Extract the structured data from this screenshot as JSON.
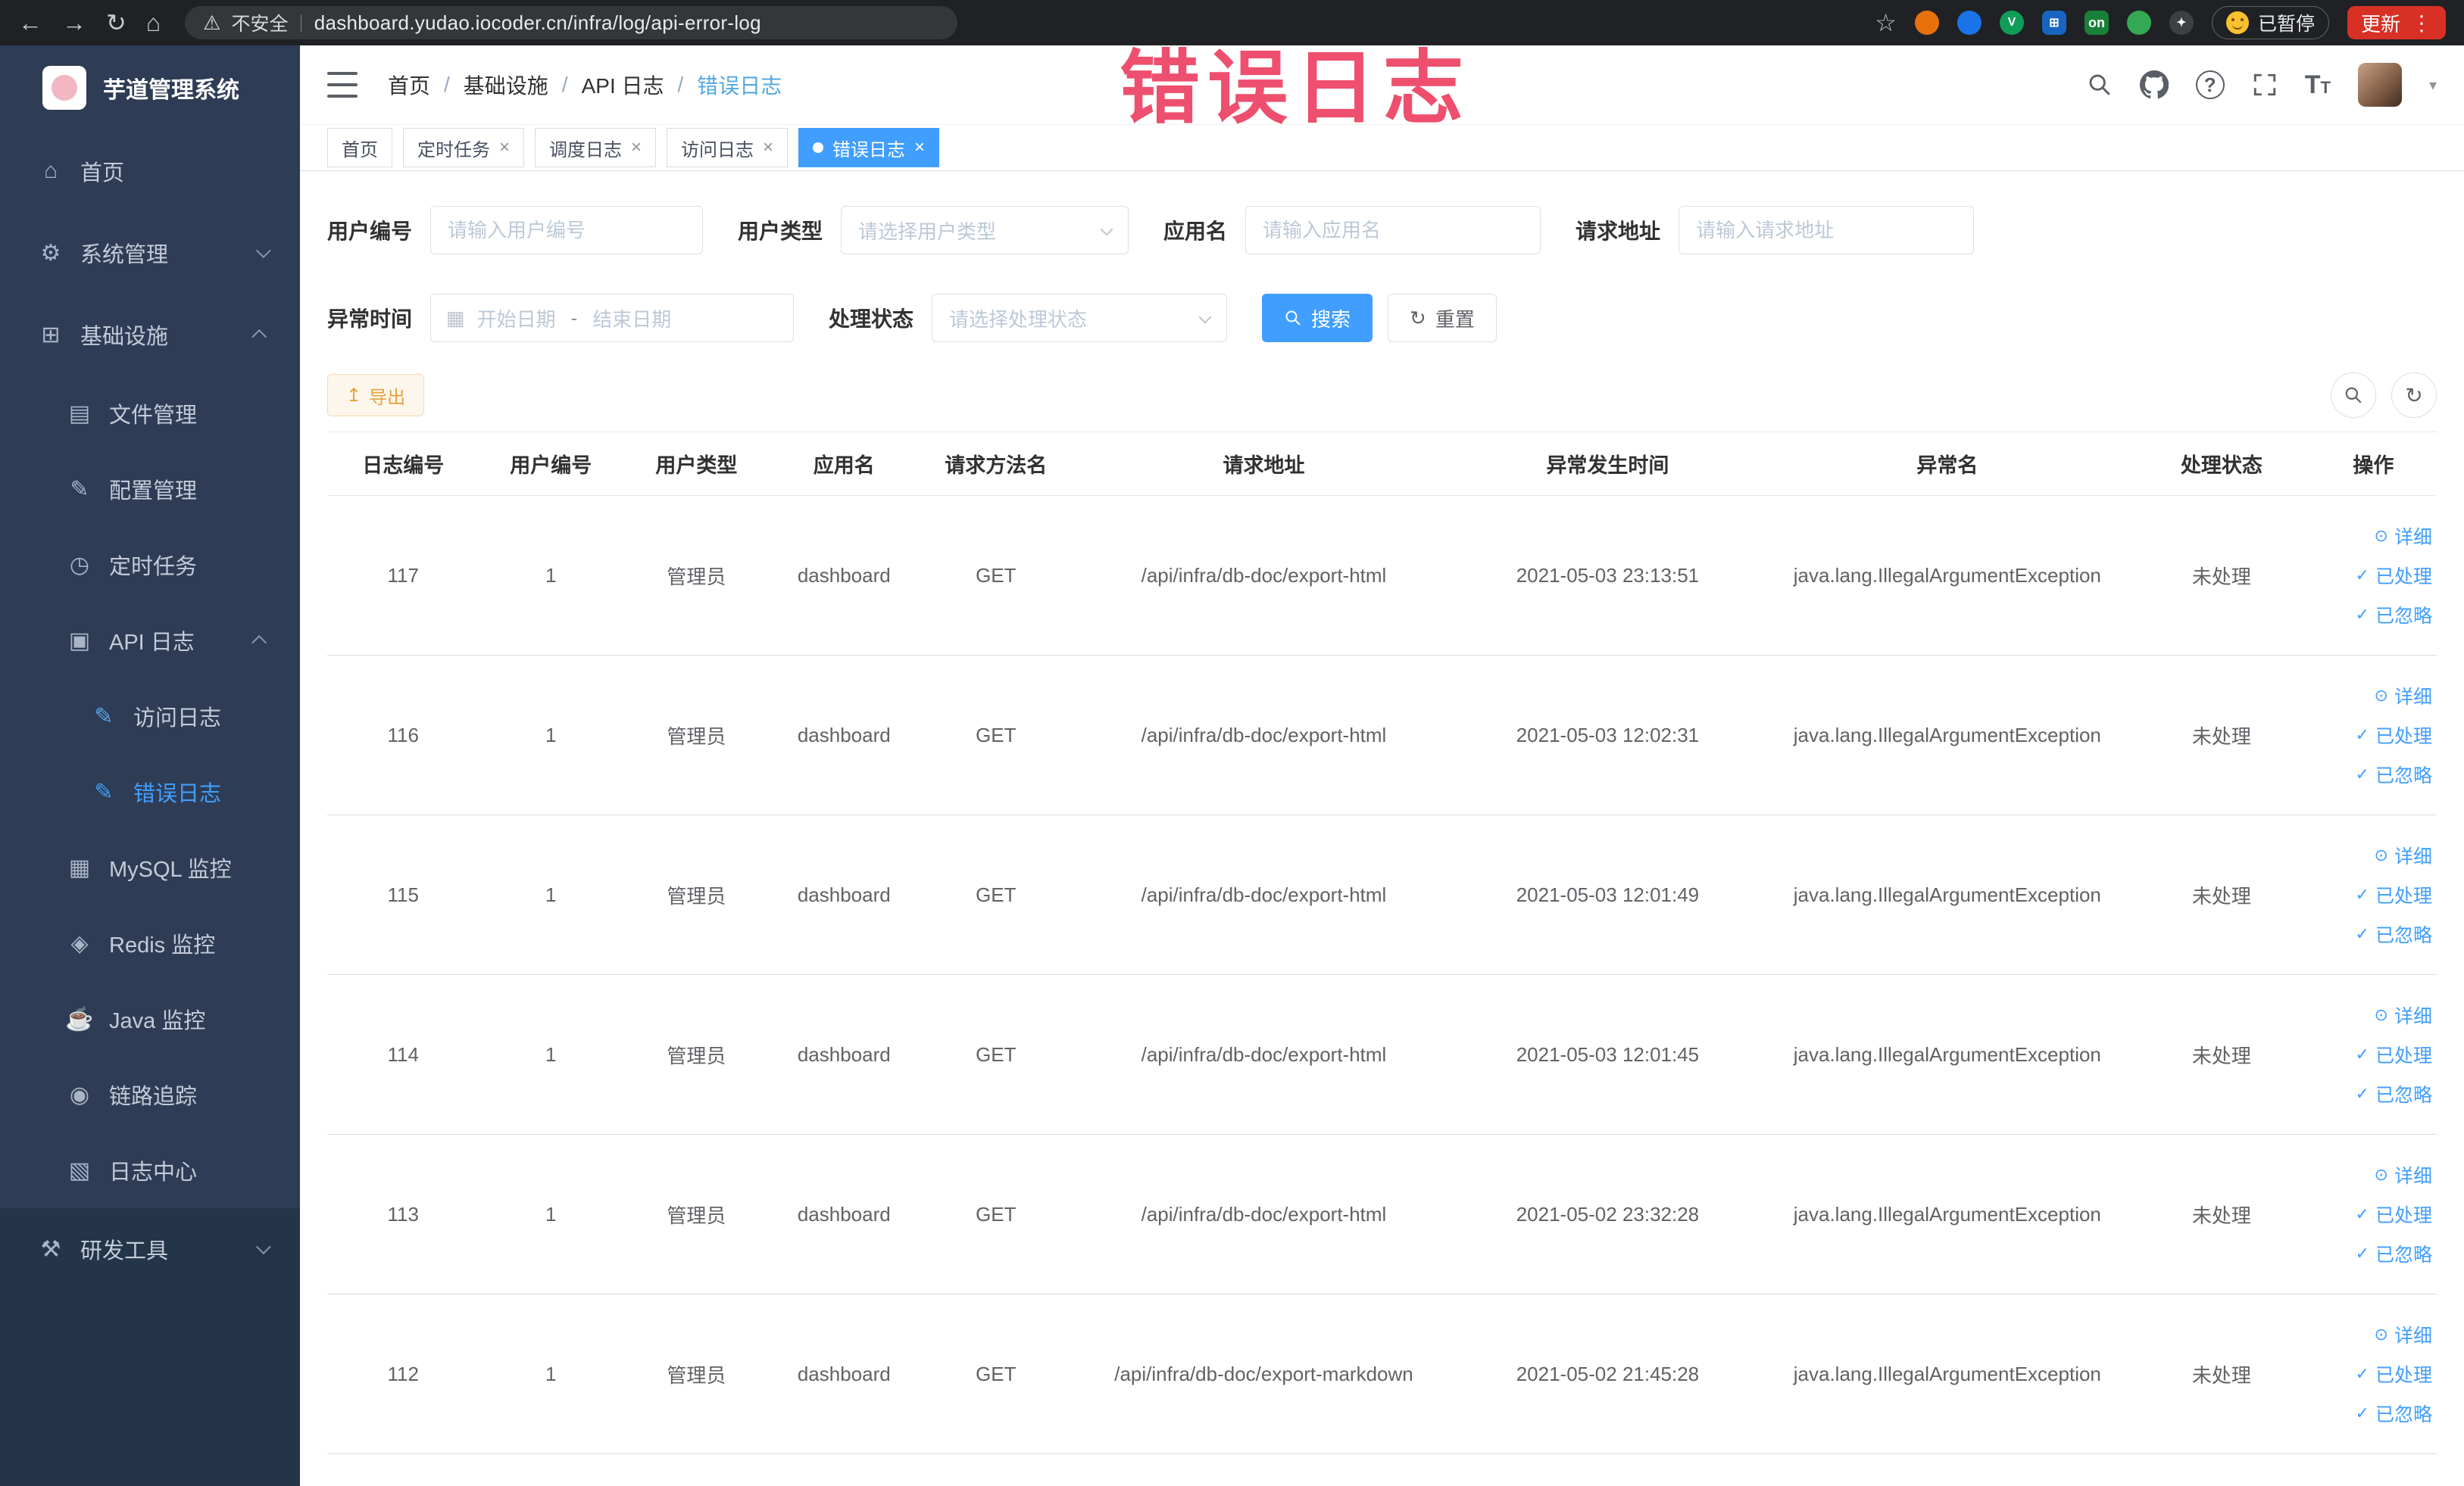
{
  "colors": {
    "accent": "#409eff",
    "warning": "#e6a23c",
    "watermark": "#ee4f6e",
    "sidebar_bg": "#2e3c55",
    "update_button": "#d93025"
  },
  "browser": {
    "security_label": "不安全",
    "url": "dashboard.yudao.iocoder.cn/infra/log/api-error-log",
    "extension_on_label": "on",
    "paused_badge": "已暂停",
    "update_label": "更新"
  },
  "sidebar": {
    "title": "芋道管理系统",
    "items": [
      {
        "label": "首页"
      },
      {
        "label": "系统管理"
      },
      {
        "label": "基础设施"
      },
      {
        "label": "文件管理"
      },
      {
        "label": "配置管理"
      },
      {
        "label": "定时任务"
      },
      {
        "label": "API 日志"
      },
      {
        "label": "访问日志"
      },
      {
        "label": "错误日志"
      },
      {
        "label": "MySQL 监控"
      },
      {
        "label": "Redis 监控"
      },
      {
        "label": "Java 监控"
      },
      {
        "label": "链路追踪"
      },
      {
        "label": "日志中心"
      },
      {
        "label": "研发工具"
      }
    ]
  },
  "header": {
    "breadcrumb": [
      "首页",
      "基础设施",
      "API 日志",
      "错误日志"
    ],
    "watermark": "错误日志"
  },
  "tabs": {
    "items": [
      {
        "label": "首页"
      },
      {
        "label": "定时任务"
      },
      {
        "label": "调度日志"
      },
      {
        "label": "访问日志"
      },
      {
        "label": "错误日志"
      }
    ]
  },
  "filters": {
    "user_id_label": "用户编号",
    "user_id_placeholder": "请输入用户编号",
    "user_type_label": "用户类型",
    "user_type_placeholder": "请选择用户类型",
    "app_name_label": "应用名",
    "app_name_placeholder": "请输入应用名",
    "request_url_label": "请求地址",
    "request_url_placeholder": "请输入请求地址",
    "exception_time_label": "异常时间",
    "start_date_placeholder": "开始日期",
    "end_date_placeholder": "结束日期",
    "range_separator": "-",
    "process_status_label": "处理状态",
    "process_status_placeholder": "请选择处理状态",
    "search_label": "搜索",
    "reset_label": "重置"
  },
  "toolbar": {
    "export_label": "导出"
  },
  "table": {
    "columns": [
      "日志编号",
      "用户编号",
      "用户类型",
      "应用名",
      "请求方法名",
      "请求地址",
      "异常发生时间",
      "异常名",
      "处理状态",
      "操作"
    ],
    "action_labels": {
      "detail": "详细",
      "processed": "已处理",
      "ignored": "已忽略"
    },
    "rows": [
      {
        "log_id": "117",
        "user_id": "1",
        "user_type": "管理员",
        "app_name": "dashboard",
        "method": "GET",
        "url": "/api/infra/db-doc/export-html",
        "time": "2021-05-03 23:13:51",
        "exception": "java.lang.IllegalArgumentException",
        "status": "未处理"
      },
      {
        "log_id": "116",
        "user_id": "1",
        "user_type": "管理员",
        "app_name": "dashboard",
        "method": "GET",
        "url": "/api/infra/db-doc/export-html",
        "time": "2021-05-03 12:02:31",
        "exception": "java.lang.IllegalArgumentException",
        "status": "未处理"
      },
      {
        "log_id": "115",
        "user_id": "1",
        "user_type": "管理员",
        "app_name": "dashboard",
        "method": "GET",
        "url": "/api/infra/db-doc/export-html",
        "time": "2021-05-03 12:01:49",
        "exception": "java.lang.IllegalArgumentException",
        "status": "未处理"
      },
      {
        "log_id": "114",
        "user_id": "1",
        "user_type": "管理员",
        "app_name": "dashboard",
        "method": "GET",
        "url": "/api/infra/db-doc/export-html",
        "time": "2021-05-03 12:01:45",
        "exception": "java.lang.IllegalArgumentException",
        "status": "未处理"
      },
      {
        "log_id": "113",
        "user_id": "1",
        "user_type": "管理员",
        "app_name": "dashboard",
        "method": "GET",
        "url": "/api/infra/db-doc/export-html",
        "time": "2021-05-02 23:32:28",
        "exception": "java.lang.IllegalArgumentException",
        "status": "未处理"
      },
      {
        "log_id": "112",
        "user_id": "1",
        "user_type": "管理员",
        "app_name": "dashboard",
        "method": "GET",
        "url": "/api/infra/db-doc/export-markdown",
        "time": "2021-05-02 21:45:28",
        "exception": "java.lang.IllegalArgumentException",
        "status": "未处理"
      }
    ]
  }
}
